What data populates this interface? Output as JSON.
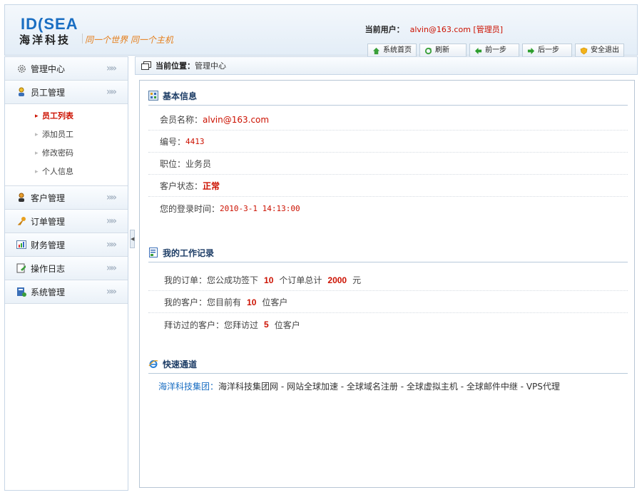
{
  "header": {
    "logo_top": "ID(SEA",
    "logo_bottom": "海洋科技",
    "slogan": "同一个世界 同一个主机",
    "user_label": "当前用户：",
    "user_value": "alvin@163.com [管理员]",
    "toolbar": [
      {
        "label": "系统首页",
        "icon": "home-icon"
      },
      {
        "label": "刷新",
        "icon": "refresh-icon"
      },
      {
        "label": "前一步",
        "icon": "back-arrow-icon"
      },
      {
        "label": "后一步",
        "icon": "forward-arrow-icon"
      },
      {
        "label": "安全退出",
        "icon": "shield-exit-icon"
      }
    ]
  },
  "sidebar": {
    "items": [
      {
        "label": "管理中心",
        "icon": "gear-icon"
      },
      {
        "label": "员工管理",
        "icon": "user-icon"
      },
      {
        "label": "客户管理",
        "icon": "customer-icon"
      },
      {
        "label": "订单管理",
        "icon": "key-icon"
      },
      {
        "label": "财务管理",
        "icon": "chart-icon"
      },
      {
        "label": "操作日志",
        "icon": "log-icon"
      },
      {
        "label": "系统管理",
        "icon": "settings-icon"
      }
    ],
    "sub_items": [
      "员工列表",
      "添加员工",
      "修改密码",
      "个人信息"
    ],
    "arrows": "»»"
  },
  "breadcrumb": {
    "label": "当前位置：",
    "value": "管理中心"
  },
  "basic_info": {
    "title": "基本信息",
    "member_label": "会员名称：",
    "member_value": "alvin@163.com",
    "id_label": "编号：",
    "id_value": "4413",
    "position_label": "职位：",
    "position_value": "业务员",
    "status_label": "客户状态：",
    "status_value": "正常",
    "login_label": "您的登录时间：",
    "login_value": "2010-3-1 14:13:00"
  },
  "work_record": {
    "title": "我的工作记录",
    "orders_pre": "我的订单：您公成功签下",
    "orders_count": "10",
    "orders_mid": "个订单总计",
    "orders_total": "2000",
    "orders_unit": "元",
    "customers_pre": "我的客户：您目前有",
    "customers_count": "10",
    "customers_unit": "位客户",
    "visited_pre": "拜访过的客户：您拜访过",
    "visited_count": "5",
    "visited_unit": "位客户"
  },
  "quick": {
    "title": "快速通道",
    "group": "海洋科技集团：",
    "links": "海洋科技集团网 - 网站全球加速 - 全球域名注册 - 全球虚拟主机 - 全球邮件中继 - VPS代理"
  },
  "colors": {
    "accent": "#1a6ec2",
    "red": "#cc1100",
    "border": "#c7d6e6"
  }
}
